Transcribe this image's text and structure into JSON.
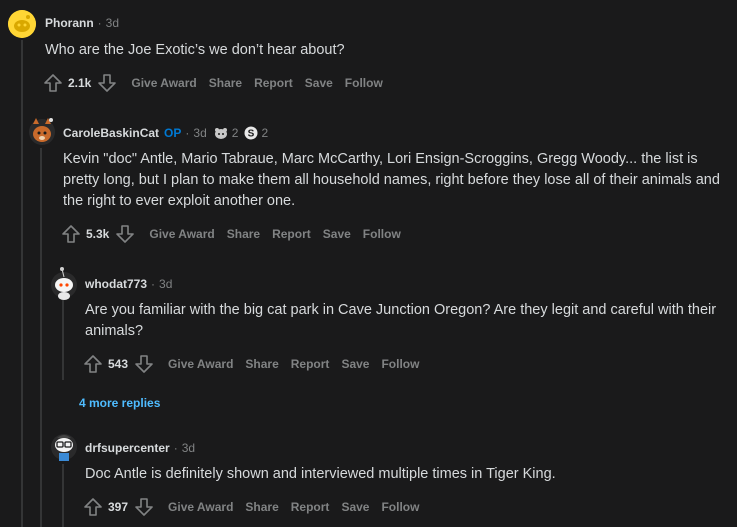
{
  "comments": [
    {
      "username": "Phorann",
      "time": "3d",
      "text": "Who are the Joe Exotic’s we don’t hear about?",
      "votes": "2.1k",
      "actions": [
        "Give Award",
        "Share",
        "Report",
        "Save",
        "Follow"
      ]
    },
    {
      "username": "CaroleBaskinCat",
      "flair": "OP",
      "time": "3d",
      "awards": [
        {
          "icon": "award-animal-icon",
          "count": "2"
        },
        {
          "icon": "silver-award-icon",
          "count": "2"
        }
      ],
      "text": "Kevin \"doc\" Antle, Mario Tabraue, Marc McCarthy, Lori Ensign-Scroggins, Gregg Woody... the list is pretty long, but I plan to make them all household names, right before they lose all of their animals and the right to ever exploit another one.",
      "votes": "5.3k",
      "actions": [
        "Give Award",
        "Share",
        "Report",
        "Save",
        "Follow"
      ]
    },
    {
      "username": "whodat773",
      "time": "3d",
      "text": "Are you familiar with the big cat park in Cave Junction Oregon? Are they legit and careful with their animals?",
      "votes": "543",
      "actions": [
        "Give Award",
        "Share",
        "Report",
        "Save",
        "Follow"
      ]
    },
    {
      "username": "drfsupercenter",
      "time": "3d",
      "text": "Doc Antle is definitely shown and interviewed multiple times in Tiger King.",
      "votes": "397",
      "actions": [
        "Give Award",
        "Share",
        "Report",
        "Save",
        "Follow"
      ]
    }
  ],
  "more_replies": "4 more replies",
  "colors": {
    "background": "#1a1a1b",
    "text": "#d7dadc",
    "muted": "#818384",
    "link": "#4fbcff",
    "op": "#0079d3"
  }
}
